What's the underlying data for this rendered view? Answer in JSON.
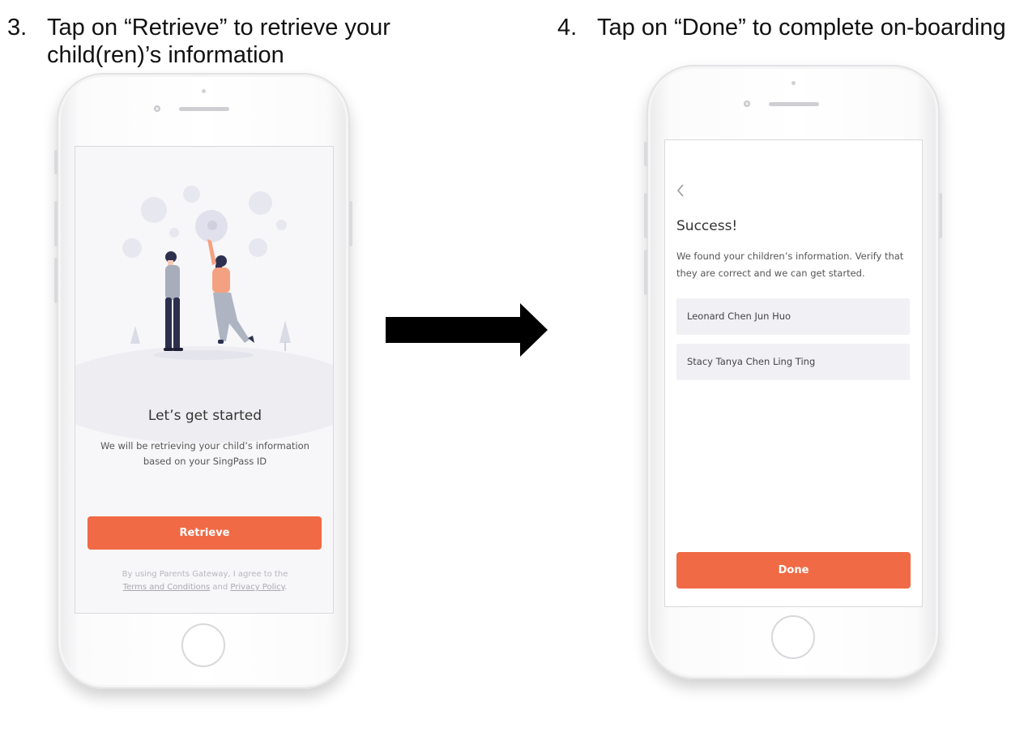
{
  "steps": [
    {
      "number": "3.",
      "text": "Tap on “Retrieve” to retrieve your\nchild(ren)’s information"
    },
    {
      "number": "4.",
      "text": "Tap on “Done” to complete on-boarding"
    }
  ],
  "screen_left": {
    "title": "Let’s get started",
    "description": "We will be retrieving your child’s information based on your SingPass ID",
    "button_label": "Retrieve",
    "legal": {
      "prefix": "By using Parents Gateway, I agree to the",
      "terms": "Terms and Conditions",
      "conjunction": "and",
      "privacy": "Privacy Policy",
      "suffix": "."
    }
  },
  "screen_right": {
    "title": "Success!",
    "description": "We found your children’s information. Verify that they are correct and we can get started.",
    "children": [
      "Leonard Chen Jun Huo",
      "Stacy Tanya Chen Ling Ting"
    ],
    "button_label": "Done"
  },
  "colors": {
    "accent": "#f06a45",
    "screen_background": "#f7f7f9",
    "row_background": "#f1f1f5"
  },
  "icons": {
    "back": "chevron-left-icon",
    "flow": "right-arrow-icon"
  }
}
